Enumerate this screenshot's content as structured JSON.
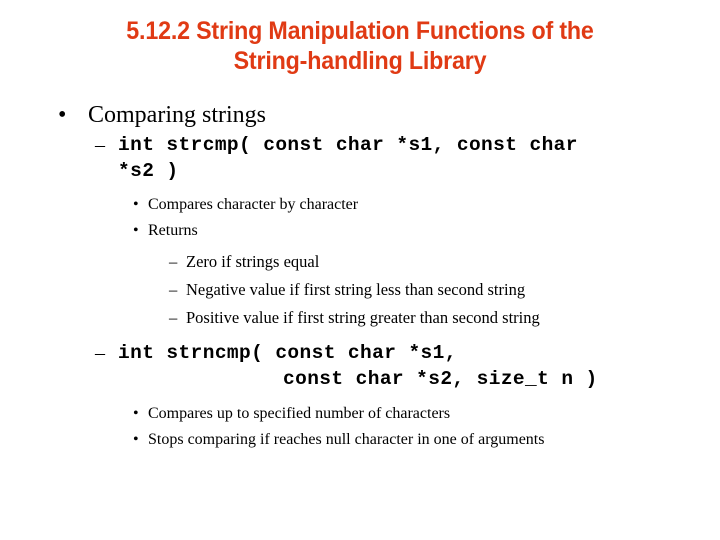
{
  "slide": {
    "title": "5.12.2 String Manipulation Functions of the\nString-handling Library",
    "title_color": "#E03A14",
    "background_color": "#FFFFFF",
    "text_color": "#000000",
    "bullet_glyphs": {
      "round": "•",
      "dash": "–"
    },
    "outline": [
      {
        "level": 1,
        "bullet": "round",
        "text": "Comparing strings"
      },
      {
        "level": 2,
        "bullet": "dash",
        "code": true,
        "line1": "int strcmp( const char *s1, const char",
        "line2": "*s2 )",
        "line2_indented": false
      },
      {
        "level": 3,
        "bullet": "round",
        "text": "Compares character by character"
      },
      {
        "level": 3,
        "bullet": "round",
        "text": "Returns"
      },
      {
        "level": 4,
        "bullet": "dash",
        "text": "Zero if strings equal"
      },
      {
        "level": 4,
        "bullet": "dash",
        "text": "Negative value if first string less than second string"
      },
      {
        "level": 4,
        "bullet": "dash",
        "text": "Positive value if first string greater than second string"
      },
      {
        "level": 2,
        "bullet": "dash",
        "code": true,
        "line1": "int strncmp( const char *s1,",
        "line2": "const char *s2, size_t n )",
        "line2_indented": true
      },
      {
        "level": 3,
        "bullet": "round",
        "text": "Compares up to specified number of characters"
      },
      {
        "level": 3,
        "bullet": "round",
        "text": "Stops comparing if reaches null character in one of arguments"
      }
    ]
  }
}
